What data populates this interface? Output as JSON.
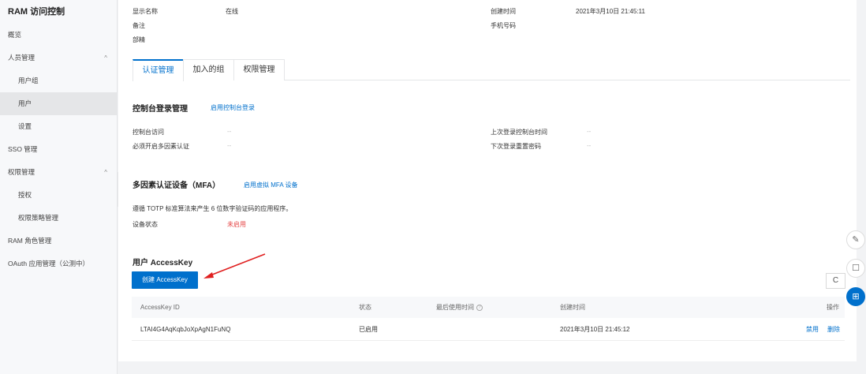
{
  "sidebar": {
    "title": "RAM 访问控制",
    "items": [
      {
        "label": "概览"
      },
      {
        "label": "人员管理",
        "chevron": "^"
      },
      {
        "label": "用户组"
      },
      {
        "label": "用户"
      },
      {
        "label": "设置"
      },
      {
        "label": "SSO 管理"
      },
      {
        "label": "权限管理",
        "chevron": "^"
      },
      {
        "label": "授权"
      },
      {
        "label": "权限策略管理"
      },
      {
        "label": "RAM 角色管理"
      },
      {
        "label": "OAuth 应用管理（公测中）"
      }
    ],
    "collapse_glyph": "‹"
  },
  "info": {
    "display_name_label": "显示名称",
    "display_name_value": "在线",
    "remark_label": "备注",
    "dept_label": "部精",
    "created_label": "创建时间",
    "created_value": "2021年3月10日 21:45:11",
    "phone_label": "手机号码"
  },
  "tabs": [
    "认证管理",
    "加入的组",
    "权限管理"
  ],
  "console": {
    "title": "控制台登录管理",
    "enable_link": "启用控制台登录",
    "access_label": "控制台访问",
    "access_value": "--",
    "mfa_required_label": "必须开启多因素认证",
    "mfa_required_value": "--",
    "last_login_label": "上次登录控制台时间",
    "last_login_value": "--",
    "reset_pwd_label": "下次登录重置密码",
    "reset_pwd_value": "--"
  },
  "mfa": {
    "title": "多因素认证设备（MFA）",
    "enable_link": "启用虚拟 MFA 设备",
    "desc": "遵循 TOTP 标准算法来产生 6 位数字验证码的应用程序。",
    "status_label": "设备状态",
    "status_value": "未启用"
  },
  "accesskey": {
    "title": "用户 AccessKey",
    "create_button": "创建 AccessKey",
    "refresh_glyph": "C",
    "columns": {
      "id": "AccessKey ID",
      "status": "状态",
      "last_used": "最后使用时间",
      "help": "?",
      "created": "创建时间",
      "ops": "操作"
    },
    "rows": [
      {
        "id": "LTAI4G4AqKqbJoXpAgN1FuNQ",
        "status": "已启用",
        "created": "2021年3月10日 21:45:12",
        "disable": "禁用",
        "delete": "删除"
      }
    ]
  },
  "float_tools": [
    "✎",
    "☐",
    "⊞"
  ],
  "colors": {
    "primary": "#0070cc",
    "danger": "#e54545",
    "arrow": "#e02020"
  }
}
